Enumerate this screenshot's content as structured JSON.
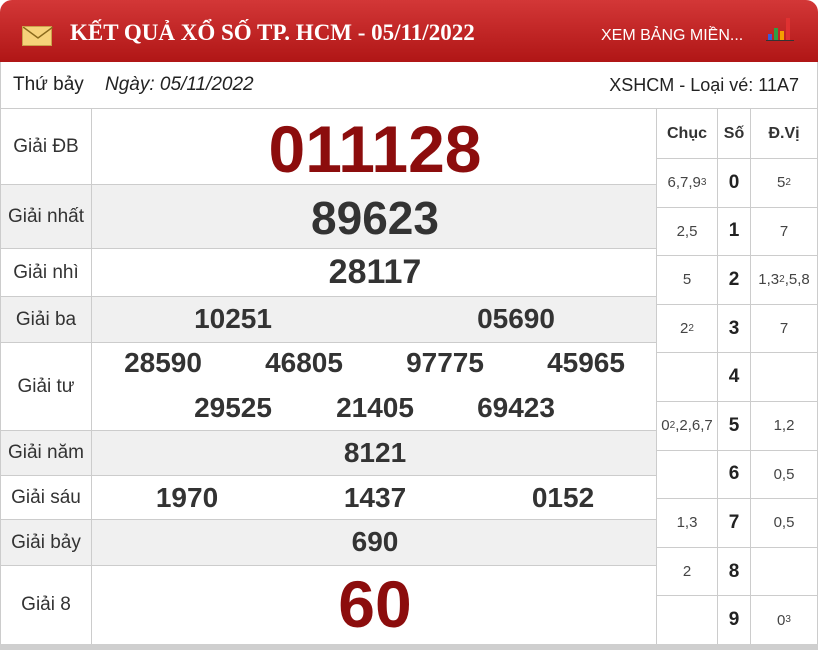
{
  "header": {
    "title": "KẾT QUẢ XỔ SỐ TP. HCM - 05/11/2022",
    "view_link": "XEM BẢNG MIỀN...",
    "bg_color": "#c12222"
  },
  "info": {
    "weekday": "Thứ bảy",
    "date": "Ngày: 05/11/2022",
    "ticket": "XSHCM - Loại vé: 11A7"
  },
  "prizes": [
    {
      "label": "Giải ĐB",
      "numbers": [
        "011128"
      ]
    },
    {
      "label": "Giải nhất",
      "numbers": [
        "89623"
      ]
    },
    {
      "label": "Giải nhì",
      "numbers": [
        "28117"
      ]
    },
    {
      "label": "Giải ba",
      "numbers": [
        "10251",
        "05690"
      ]
    },
    {
      "label": "Giải tư",
      "numbers": [
        "28590",
        "46805",
        "97775",
        "45965",
        "29525",
        "21405",
        "69423"
      ]
    },
    {
      "label": "Giải năm",
      "numbers": [
        "8121"
      ]
    },
    {
      "label": "Giải sáu",
      "numbers": [
        "1970",
        "1437",
        "0152"
      ]
    },
    {
      "label": "Giải bảy",
      "numbers": [
        "690"
      ]
    },
    {
      "label": "Giải 8",
      "numbers": [
        "60"
      ]
    }
  ],
  "loto": {
    "headers": {
      "chuc": "Chục",
      "so": "Số",
      "dv": "Đ.Vị"
    },
    "rows": [
      {
        "chuc": "6,7,9",
        "chuc_sup": "3",
        "so": "0",
        "dv": "5",
        "dv_sup": "2"
      },
      {
        "chuc": "2,5",
        "so": "1",
        "dv": "7"
      },
      {
        "chuc": "5",
        "so": "2",
        "dv": "1,3",
        "dv_sup": "2",
        "dv_tail": ",5,8"
      },
      {
        "chuc": "2",
        "chuc_sup": "2",
        "so": "3",
        "dv": "7"
      },
      {
        "chuc": "",
        "so": "4",
        "dv": ""
      },
      {
        "chuc": "0",
        "chuc_sup": "2",
        "chuc_tail": ",2,6,7",
        "so": "5",
        "dv": "1,2"
      },
      {
        "chuc": "",
        "so": "6",
        "dv": "0,5"
      },
      {
        "chuc": "1,3",
        "so": "7",
        "dv": "0,5"
      },
      {
        "chuc": "2",
        "so": "8",
        "dv": ""
      },
      {
        "chuc": "",
        "so": "9",
        "dv": "0",
        "dv_sup": "3"
      }
    ]
  }
}
